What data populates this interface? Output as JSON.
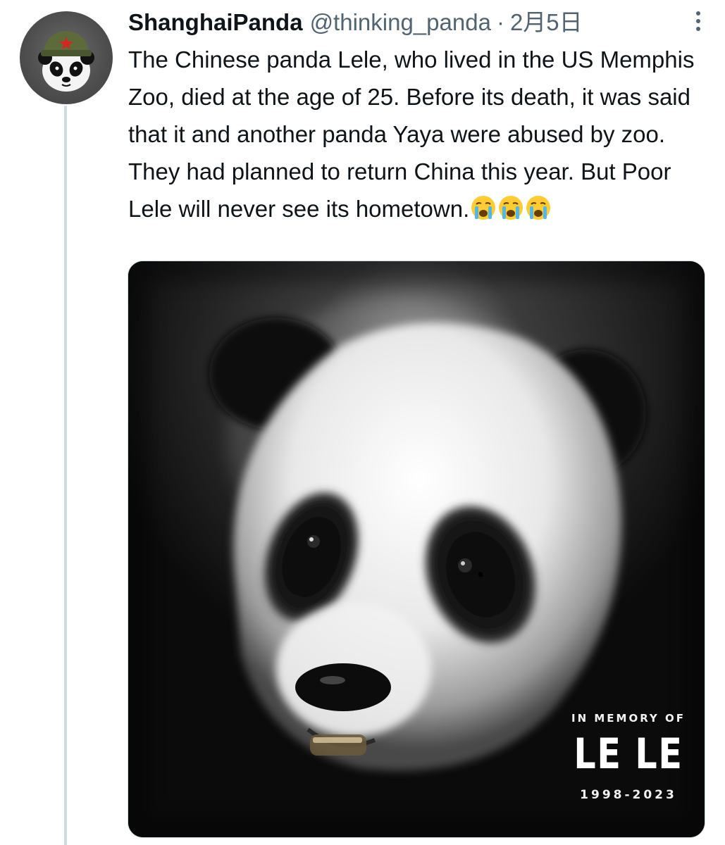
{
  "tweet": {
    "display_name": "ShanghaiPanda",
    "handle": "@thinking_panda",
    "separator": "·",
    "timestamp": "2月5日",
    "more_icon": "more-dots-icon",
    "text_paragraphs": [
      "The Chinese panda Lele, who lived in the US Memphis Zoo, died at the age of 25. Before its death, it was said that it and another panda Yaya were abused by zoo.",
      "They had planned to return China this year. But Poor Lele will never see its hometown."
    ],
    "emojis": [
      "loudly-crying-face",
      "loudly-crying-face",
      "loudly-crying-face"
    ],
    "avatar_icon": "panda-with-army-cap-avatar",
    "media": {
      "heading": "IN MEMORY OF",
      "name": "LE LE",
      "years": "1998-2023"
    }
  },
  "colors": {
    "text_primary": "#0f1419",
    "text_secondary": "#536471",
    "thread_line": "#cfd9de",
    "background": "#ffffff"
  }
}
